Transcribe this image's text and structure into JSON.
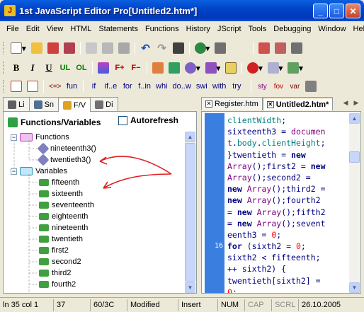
{
  "window": {
    "title": "1st JavaScript Editor Pro[Untitled2.htm*]",
    "min_glyph": "_",
    "max_glyph": "□",
    "close_glyph": "✕"
  },
  "menu": [
    "File",
    "Edit",
    "View",
    "HTML",
    "Statements",
    "Functions",
    "History",
    "JScript",
    "Tools",
    "Debugging",
    "Window",
    "Help"
  ],
  "toolbar2": {
    "bold": "B",
    "italic": "I",
    "underline": "U",
    "ul": "UL",
    "ol": "OL",
    "font_plus": "F+",
    "font_minus": "F−"
  },
  "toolbar3": {
    "fun_tag": "<=>",
    "fun": "fun",
    "if": "if",
    "ife": "if..e",
    "for": "for",
    "fin": "f..in",
    "while": "whi",
    "dowhile": "do..w",
    "switch": "swi",
    "with": "with",
    "try": "try",
    "sty": "sty",
    "fov": "fov",
    "var": "var"
  },
  "left_tabs": [
    {
      "label": "Li",
      "icon": "list-icon"
    },
    {
      "label": "Sn",
      "icon": "snippet-icon"
    },
    {
      "label": "F/V",
      "icon": "functions-icon"
    },
    {
      "label": "Di",
      "icon": "directory-icon"
    }
  ],
  "fv_panel": {
    "title": "Functions/Variables",
    "autorefresh_label": "Autorefresh",
    "functions_label": "Functions",
    "functions": [
      "nineteenth3()",
      "twentieth3()"
    ],
    "variables_label": "Variables",
    "variables": [
      "fifteenth",
      "sixteenth",
      "seventeenth",
      "eighteenth",
      "nineteenth",
      "twentieth",
      "first2",
      "second2",
      "third2",
      "fourth2"
    ]
  },
  "editor_tabs": [
    {
      "label": "Register.htm",
      "active": false
    },
    {
      "label": "Untitled2.htm*",
      "active": true
    }
  ],
  "editor": {
    "current_line_number": "16"
  },
  "statusbar": {
    "position": "ln 35 col 1",
    "count": "37",
    "ratio": "60/3C",
    "modified": "Modified",
    "mode": "Insert",
    "num": "NUM",
    "cap": "CAP",
    "scrl": "SCRL",
    "date": "26.10.2005"
  },
  "colors": {
    "titlebar": "#0045c8",
    "gutter": "#3a7ee0",
    "keyword": "#000080",
    "property": "#008080",
    "class": "#800080",
    "number": "#ff0000",
    "annotation_arrow": "#e02020"
  }
}
